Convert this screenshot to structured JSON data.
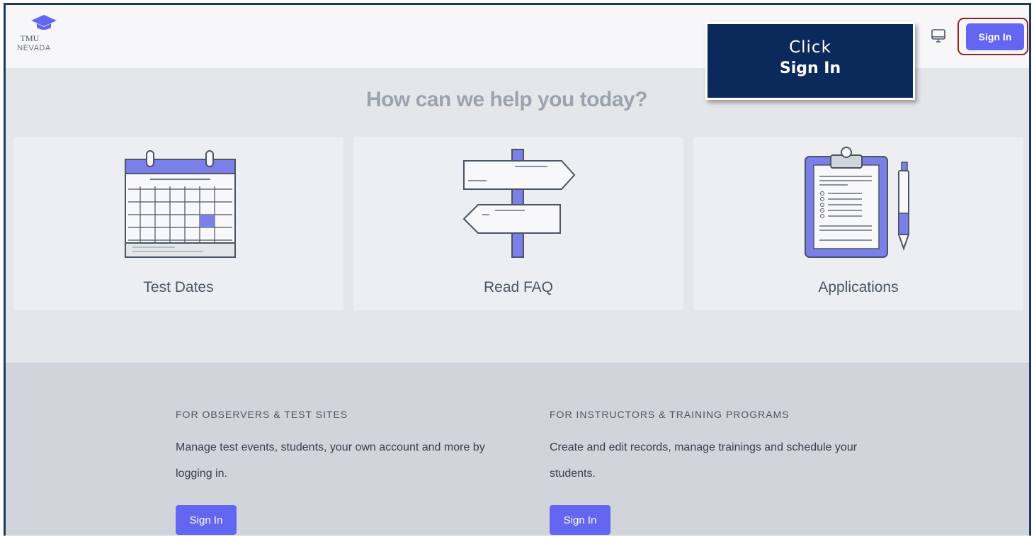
{
  "header": {
    "logo_line1": "TMU",
    "logo_line2": "NEVADA",
    "monitor_icon": "monitor-icon",
    "signin_label": "Sign In"
  },
  "callout": {
    "line1": "Click",
    "line2": "Sign In"
  },
  "main": {
    "title": "How can we help you today?",
    "cards": [
      {
        "label": "Test Dates",
        "icon": "calendar-icon"
      },
      {
        "label": "Read FAQ",
        "icon": "signpost-icon"
      },
      {
        "label": "Applications",
        "icon": "clipboard-icon"
      }
    ]
  },
  "lower": {
    "columns": [
      {
        "heading": "FOR OBSERVERS & TEST SITES",
        "text": "Manage test events, students, your own account and more by logging in.",
        "button": "Sign In"
      },
      {
        "heading": "FOR INSTRUCTORS & TRAINING PROGRAMS",
        "text": "Create and edit records, manage trainings and schedule your students.",
        "button": "Sign In"
      }
    ]
  },
  "colors": {
    "accent": "#6366f1",
    "callout_bg": "#0b2a5b",
    "frame_border": "#1f3864",
    "highlight": "#a02020"
  }
}
